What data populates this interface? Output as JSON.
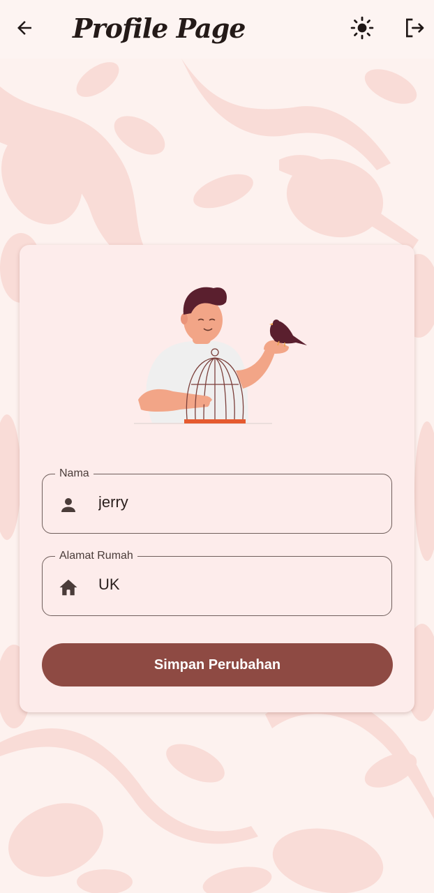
{
  "appbar": {
    "title": "Profile Page",
    "back_icon": "arrow-left-icon",
    "theme_icon": "sun-icon",
    "logout_icon": "logout-icon"
  },
  "form": {
    "name": {
      "label": "Nama",
      "value": "jerry",
      "icon": "person-icon"
    },
    "address": {
      "label": "Alamat Rumah",
      "value": "UK",
      "icon": "home-icon"
    },
    "save_label": "Simpan Perubahan"
  },
  "colors": {
    "primary": "#8e4a43",
    "card": "#fdeceb",
    "background_pattern": "#f8d7d2"
  }
}
